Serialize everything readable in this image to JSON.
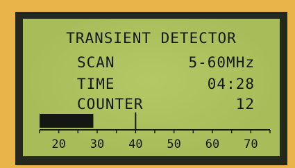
{
  "display": {
    "title": "TRANSIENT DETECTOR",
    "scan_label": "SCAN",
    "scan_value": "5-60MHz",
    "time_label": "TIME",
    "time_value": "04:28",
    "counter_label": "COUNTER",
    "counter_value": "12"
  },
  "meter": {
    "scale_labels": [
      "20",
      "30",
      "40",
      "50",
      "60",
      "70"
    ],
    "scale_min": 15,
    "scale_max": 75,
    "fill_value": 29,
    "marker_value": 40
  },
  "colors": {
    "frame": "#e9b54a",
    "bezel": "#24291c",
    "lcd_background": "#a8bc5a",
    "lcd_ink": "#151812"
  }
}
